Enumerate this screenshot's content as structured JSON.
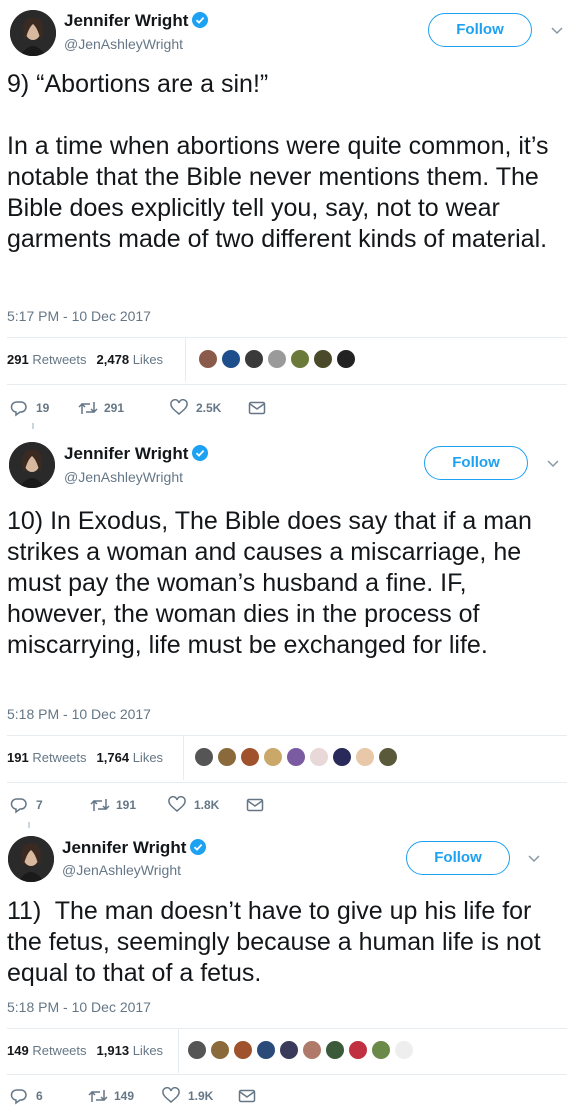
{
  "tweets": [
    {
      "author": {
        "name": "Jennifer Wright",
        "handle": "@JenAshleyWright",
        "verified": true
      },
      "follow_label": "Follow",
      "text": "9) “Abortions are a sin!”\n\nIn a time when abortions were quite common, it’s notable that the Bible never mentions them. The Bible does explicitly tell you, say, not to wear garments made of two different kinds of material.",
      "timestamp": "5:17 PM - 10 Dec 2017",
      "retweets_count": "291",
      "retweets_label": "Retweets",
      "likes_count": "2,478",
      "likes_label": "Likes",
      "liker_avatars": [
        "#8a5a4a",
        "#1f4e8c",
        "#3a3a3a",
        "#9a9a9a",
        "#6b7a3a",
        "#4a4a2a",
        "#222222"
      ],
      "actions": {
        "replies": "19",
        "retweets": "291",
        "likes": "2.5K"
      }
    },
    {
      "author": {
        "name": "Jennifer Wright",
        "handle": "@JenAshleyWright",
        "verified": true
      },
      "follow_label": "Follow",
      "text": "10) In Exodus, The Bible does say that if a man strikes a woman and causes a miscarriage, he must pay the woman’s husband a fine. IF, however, the woman dies in the process of miscarrying, life must be exchanged for life.",
      "timestamp": "5:18 PM - 10 Dec 2017",
      "retweets_count": "191",
      "retweets_label": "Retweets",
      "likes_count": "1,764",
      "likes_label": "Likes",
      "liker_avatars": [
        "#555555",
        "#8a6a3a",
        "#a0522d",
        "#c9a86a",
        "#7a5aa0",
        "#e8d8d8",
        "#2a2a5a",
        "#e8c8a8",
        "#5a5a3a"
      ],
      "actions": {
        "replies": "7",
        "retweets": "191",
        "likes": "1.8K"
      }
    },
    {
      "author": {
        "name": "Jennifer Wright",
        "handle": "@JenAshleyWright",
        "verified": true
      },
      "follow_label": "Follow",
      "text": "11)  The man doesn’t have to give up his life for the fetus, seemingly because a human life is not equal to that of a fetus.",
      "timestamp": "5:18 PM - 10 Dec 2017",
      "retweets_count": "149",
      "retweets_label": "Retweets",
      "likes_count": "1,913",
      "likes_label": "Likes",
      "liker_avatars": [
        "#555555",
        "#8a6a3a",
        "#a0522d",
        "#2a4a7a",
        "#3a3a5a",
        "#b07a6a",
        "#3a5a3a",
        "#c03040",
        "#6a8a4a",
        "#eeeeee"
      ],
      "actions": {
        "replies": "6",
        "retweets": "149",
        "likes": "1.9K"
      }
    }
  ],
  "colors": {
    "accent": "#1da1f2",
    "muted": "#657786",
    "divider": "#e6ecf0",
    "text": "#14171a"
  }
}
